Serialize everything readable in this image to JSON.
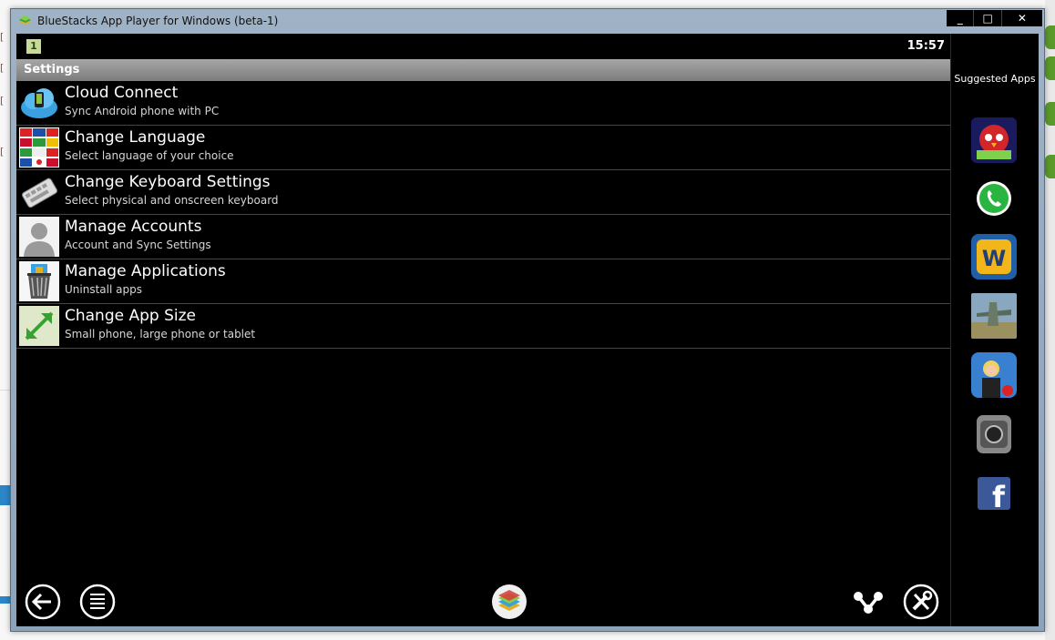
{
  "window": {
    "title": "BlueStacks App Player for Windows (beta-1)",
    "minimize_glyph": "_",
    "maximize_glyph": "□",
    "close_glyph": "✕"
  },
  "status": {
    "notification_badge": "1",
    "time": "15:57"
  },
  "settings": {
    "header": "Settings",
    "items": [
      {
        "title": "Cloud Connect",
        "subtitle": "Sync Android phone with PC",
        "icon": "cloud-connect-icon"
      },
      {
        "title": "Change Language",
        "subtitle": "Select language of your choice",
        "icon": "flags-icon"
      },
      {
        "title": "Change Keyboard Settings",
        "subtitle": "Select physical and onscreen keyboard",
        "icon": "keyboard-icon"
      },
      {
        "title": "Manage Accounts",
        "subtitle": "Account and Sync Settings",
        "icon": "user-silhouette-icon"
      },
      {
        "title": "Manage Applications",
        "subtitle": "Uninstall apps",
        "icon": "trash-can-icon"
      },
      {
        "title": "Change App Size",
        "subtitle": "Small phone, large phone or tablet",
        "icon": "resize-arrow-icon"
      }
    ]
  },
  "sidebar": {
    "title": "Suggested Apps",
    "apps": [
      {
        "name": "angry-birds-space-icon"
      },
      {
        "name": "whatsapp-icon"
      },
      {
        "name": "words-with-friends-icon"
      },
      {
        "name": "airplane-game-icon"
      },
      {
        "name": "woman-game-icon"
      },
      {
        "name": "camera-app-icon"
      },
      {
        "name": "facebook-icon"
      }
    ]
  },
  "navigation": {
    "back": "back-icon",
    "menu": "menu-icon",
    "home": "bluestacks-home-icon",
    "share": "share-icon",
    "settings": "settings-tools-icon"
  },
  "colors": {
    "window_frame": "#9fb2c6",
    "screen": "#000000",
    "settings_header": "#8d8d8d",
    "desktop_band": "#2b86c8"
  }
}
